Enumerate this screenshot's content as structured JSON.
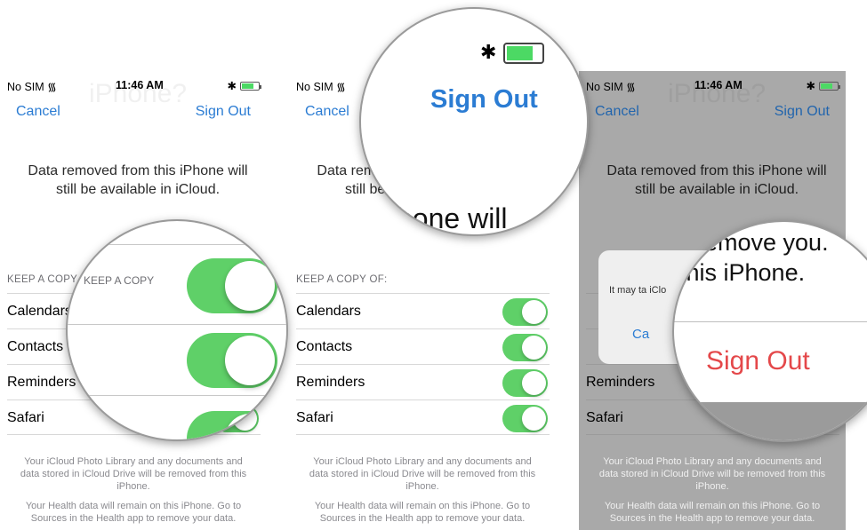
{
  "status": {
    "carrier": "No SIM",
    "time": "11:46 AM",
    "ghost_text": "iPhone?"
  },
  "nav": {
    "cancel": "Cancel",
    "sign_out": "Sign Out"
  },
  "description": "Data removed from this iPhone will still be available in iCloud.",
  "section_header": "KEEP A COPY OF:",
  "rows": [
    "Calendars",
    "Contacts",
    "Reminders",
    "Safari"
  ],
  "footer": {
    "photo": "Your iCloud Photo Library and any documents and data stored in iCloud Drive will be removed from this iPhone.",
    "health": "Your Health data will remain on this iPhone. Go to Sources in the Health app to remove your data."
  },
  "dialog": {
    "message_fragment": "It may ta iClo",
    "cancel_fragment": "Ca"
  },
  "zoom": {
    "lens1_row_partial": "KEEP A COPY",
    "lens2_sign_out": "Sign Out",
    "lens2_partial": "hone will",
    "lens3_line1": "remove you.",
    "lens3_line2": "this iPhone.",
    "lens3_sign_out": "Sign Out"
  },
  "colors": {
    "ios_blue": "#2b7cd3",
    "toggle_green": "#5fd068",
    "destructive_red": "#e4484a",
    "dim_overlay": "#a9a9a9"
  }
}
